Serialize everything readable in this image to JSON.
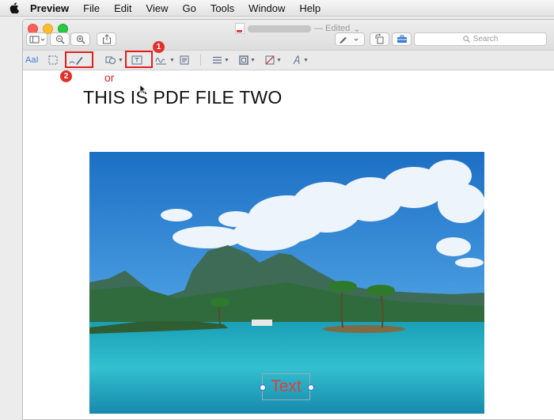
{
  "menubar": {
    "items": [
      "Preview",
      "File",
      "Edit",
      "View",
      "Go",
      "Tools",
      "Window",
      "Help"
    ]
  },
  "window": {
    "title_suffix": "— Edited",
    "title_chevron": "⌄",
    "search_placeholder": "Search"
  },
  "toolbar": {
    "icons": [
      "sidebar-icon",
      "zoom-out-icon",
      "zoom-in-icon",
      "share-icon",
      "pen-icon",
      "rotate-icon",
      "toolbox-icon"
    ]
  },
  "markup": {
    "text_style_label": "AaI",
    "tools": [
      "text-selection-icon",
      "rectangular-selection-icon",
      "sketch-icon",
      "shapes-icon",
      "text-box-icon",
      "sign-icon",
      "note-icon",
      "line-style-icon",
      "border-color-icon",
      "fill-color-icon",
      "text-style-icon"
    ]
  },
  "annotations": {
    "badge_1": "1",
    "badge_2": "2",
    "or_label": "or",
    "highlight_color": "#e02020"
  },
  "document": {
    "heading": "THIS IS PDF FILE TWO",
    "text_box_value": "Text",
    "text_color": "#e53b3b"
  }
}
